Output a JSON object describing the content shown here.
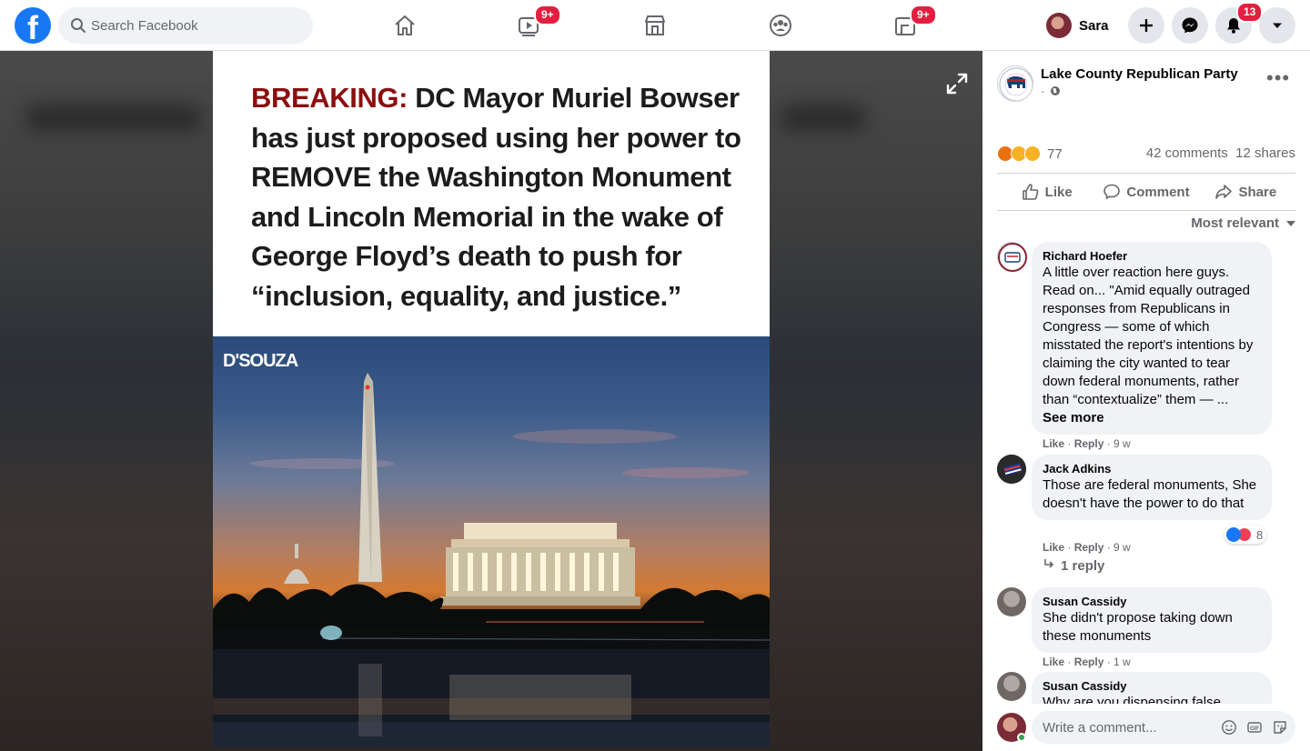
{
  "header": {
    "search_placeholder": "Search Facebook",
    "nav": [
      {
        "name": "home",
        "badge": ""
      },
      {
        "name": "watch",
        "badge": "9+"
      },
      {
        "name": "marketplace",
        "badge": ""
      },
      {
        "name": "groups",
        "badge": ""
      },
      {
        "name": "gaming",
        "badge": "9+"
      }
    ],
    "user_name": "Sara",
    "notifications_badge": "13",
    "brand_color": "#1877f2",
    "badge_color": "#e41e3f"
  },
  "photo": {
    "headline_highlight": "BREAKING:",
    "headline_rest": " DC Mayor Muriel Bowser has just proposed using her power to REMOVE the Washington Monument and Lincoln Memorial in the wake of George Floyd’s death to push for “inclusion, equality, and justice.”",
    "watermark": "D'SOUZA"
  },
  "post": {
    "page_name": "Lake County Republican Party",
    "page_meta": "·",
    "reaction_count": "77",
    "comments_count": "42 comments",
    "shares_count": "12 shares",
    "actions": {
      "like": "Like",
      "comment": "Comment",
      "share": "Share"
    },
    "sort_label": "Most relevant"
  },
  "comments": [
    {
      "name": "Richard Hoefer",
      "text": "A little over reaction here guys. Read on... \"Amid equally outraged responses from Republicans in Congress — some of which misstated the report's intentions by claiming the city wanted to tear down federal monuments, rather than “contextualize” them — ...",
      "see_more": "See more",
      "like": "Like",
      "reply": "Reply",
      "time": "9 w"
    },
    {
      "name": "Jack Adkins",
      "text": "Those are federal monuments, She doesn't have the power to do that",
      "reaction_count": "8",
      "like": "Like",
      "reply": "Reply",
      "time": "9 w",
      "replies": "1 reply"
    },
    {
      "name": "Susan Cassidy",
      "text": "She didn't propose taking down these monuments",
      "like": "Like",
      "reply": "Reply",
      "time": "1 w"
    },
    {
      "name": "Susan Cassidy",
      "text": "Why are you dispensing false",
      "like": "",
      "reply": "",
      "time": ""
    }
  ],
  "composer": {
    "placeholder": "Write a comment..."
  }
}
